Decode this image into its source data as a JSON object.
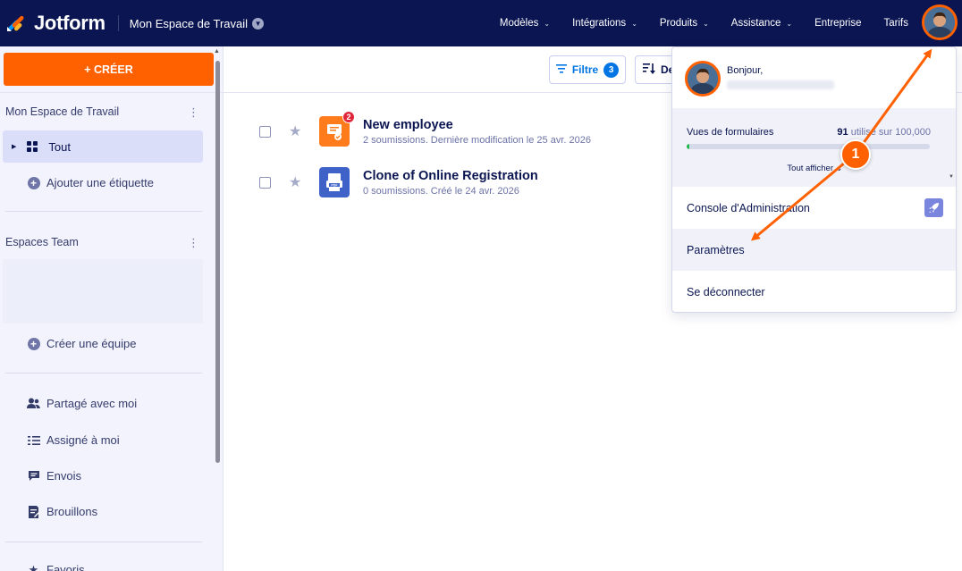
{
  "app": {
    "name": "Jotform",
    "workspace": "Mon Espace de Travail"
  },
  "topnav": [
    {
      "label": "Modèles",
      "chevron": true
    },
    {
      "label": "Intégrations",
      "chevron": true
    },
    {
      "label": "Produits",
      "chevron": true
    },
    {
      "label": "Assistance",
      "chevron": true
    },
    {
      "label": "Entreprise",
      "chevron": false
    },
    {
      "label": "Tarifs",
      "chevron": false
    }
  ],
  "sidebar": {
    "create_label": "+ CRÉER",
    "workspace_heading": "Mon Espace de Travail",
    "tout_label": "Tout",
    "add_tag_label": "Ajouter une étiquette",
    "teams_heading": "Espaces Team",
    "create_team_label": "Créer une équipe",
    "items": [
      {
        "label": "Partagé avec moi",
        "icon": "users-icon"
      },
      {
        "label": "Assigné à moi",
        "icon": "checklist-icon"
      },
      {
        "label": "Envois",
        "icon": "message-icon"
      },
      {
        "label": "Brouillons",
        "icon": "draft-icon"
      }
    ],
    "favorites_label": "Favoris"
  },
  "toolbar": {
    "filter_label": "Filtre",
    "filter_count": "3",
    "sort_label": "De"
  },
  "forms": [
    {
      "title": "New employee",
      "subtitle": "2 soumissions. Dernière modification le 25 avr. 2026",
      "badge": "2",
      "icon_color": "#ff7b1c"
    },
    {
      "title": "Clone of Online Registration",
      "subtitle": "0 soumissions. Créé le 24 avr. 2026",
      "badge": "",
      "icon_color": "#3e62c8"
    }
  ],
  "account_menu": {
    "greeting": "Bonjour,",
    "usage_label": "Vues de formulaires",
    "usage_used": "91",
    "usage_suffix": "utilisé sur 100,000",
    "usage_fraction": 0.00091,
    "show_all": "Tout afficher",
    "items": [
      {
        "label": "Console d'Administration"
      },
      {
        "label": "Paramètres"
      },
      {
        "label": "Se déconnecter"
      }
    ]
  },
  "annotation": {
    "step": "1",
    "color": "#ff6100"
  },
  "colors": {
    "navy": "#0a1551",
    "orange": "#ff6100",
    "blue": "#0075e3",
    "sidebar_bg": "#f3f3fe"
  }
}
